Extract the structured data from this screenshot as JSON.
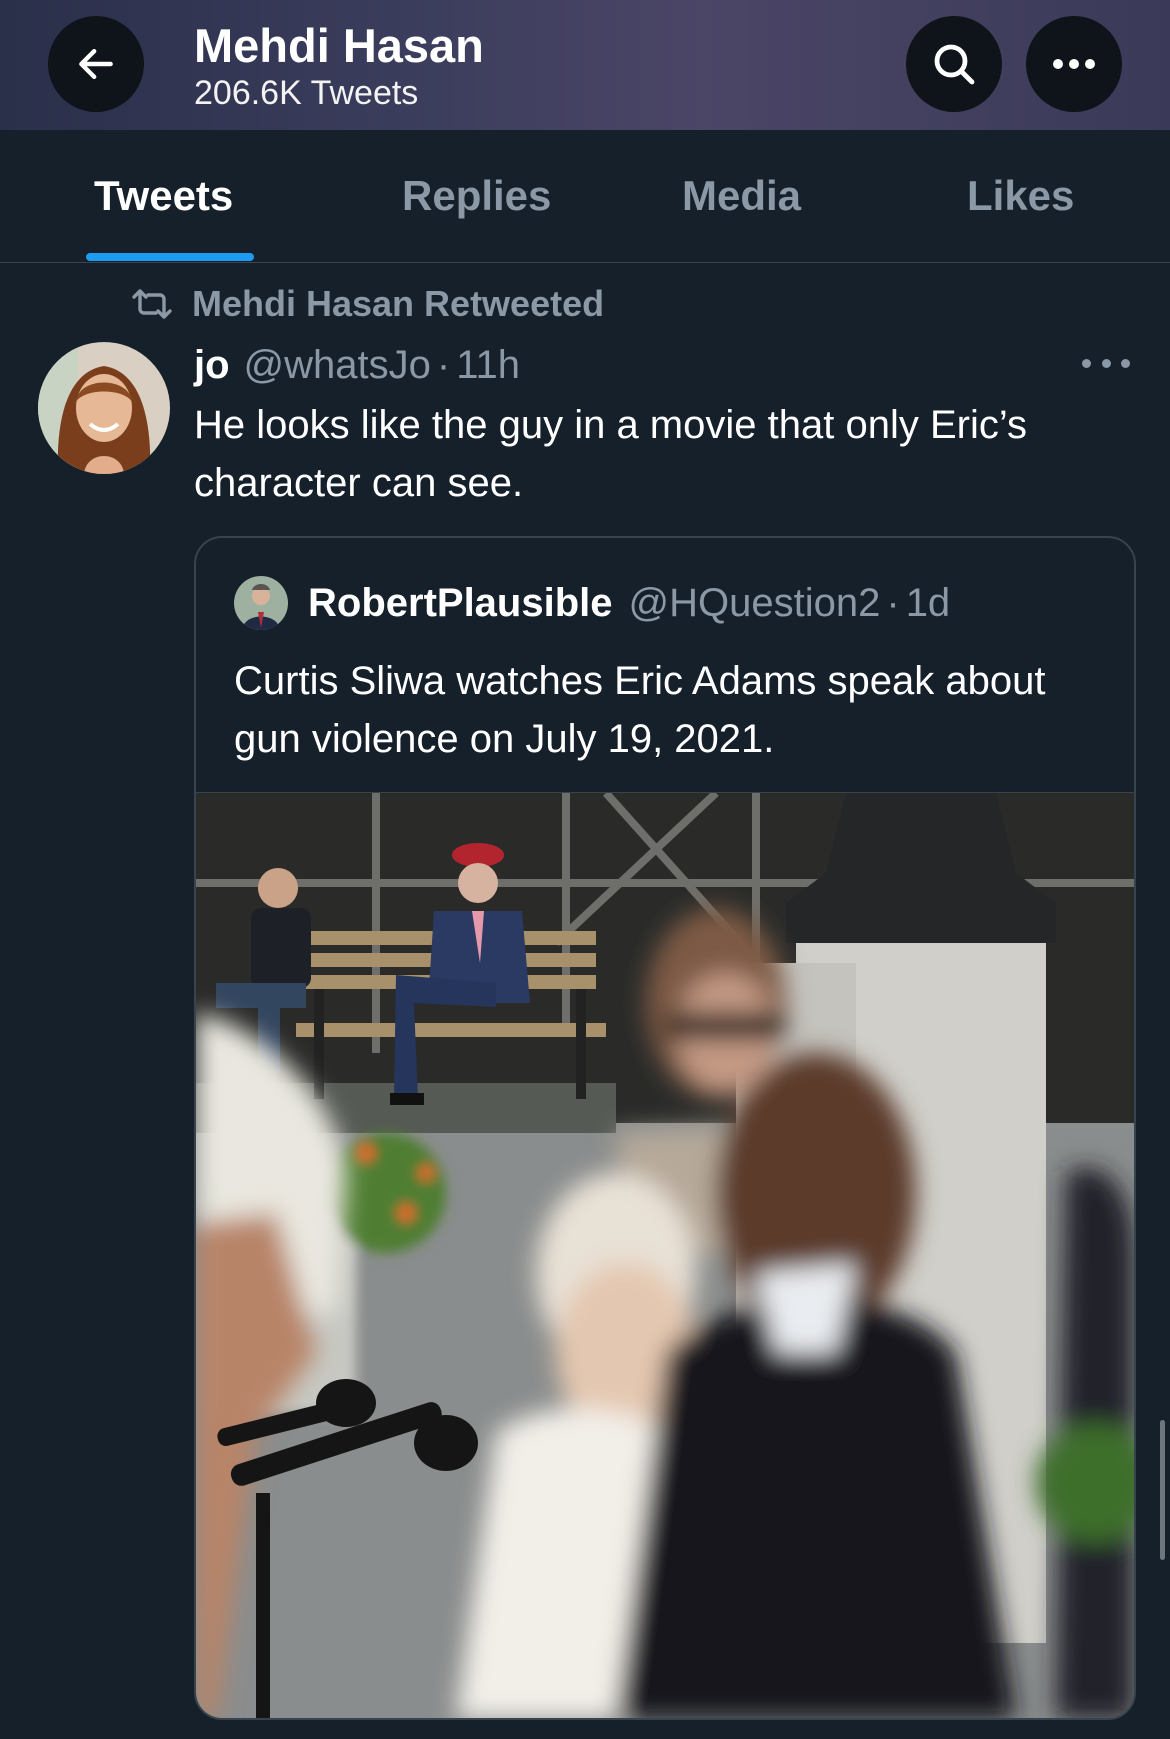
{
  "header": {
    "title": "Mehdi Hasan",
    "subtitle": "206.6K Tweets",
    "back_icon": "arrow-left-icon",
    "search_icon": "search-icon",
    "more_icon": "more-horizontal-icon"
  },
  "tabs": [
    {
      "label": "Tweets",
      "active": true
    },
    {
      "label": "Replies",
      "active": false
    },
    {
      "label": "Media",
      "active": false
    },
    {
      "label": "Likes",
      "active": false
    }
  ],
  "tweet": {
    "retweet_label": "Mehdi Hasan Retweeted",
    "author_name": "jo",
    "author_handle": "@whatsJo",
    "separator": "·",
    "time": "11h",
    "text": "He looks like the guy in a movie that only Eric’s character can see.",
    "quote": {
      "author_name": "RobertPlausible",
      "author_handle": "@HQuestion2",
      "separator": "·",
      "time": "1d",
      "text": "Curtis Sliwa watches Eric Adams speak about gun violence on July 19, 2021."
    }
  },
  "colors": {
    "background": "#15202b",
    "accent": "#1d9bf0",
    "muted": "#8b98a5",
    "border": "#38444d"
  }
}
